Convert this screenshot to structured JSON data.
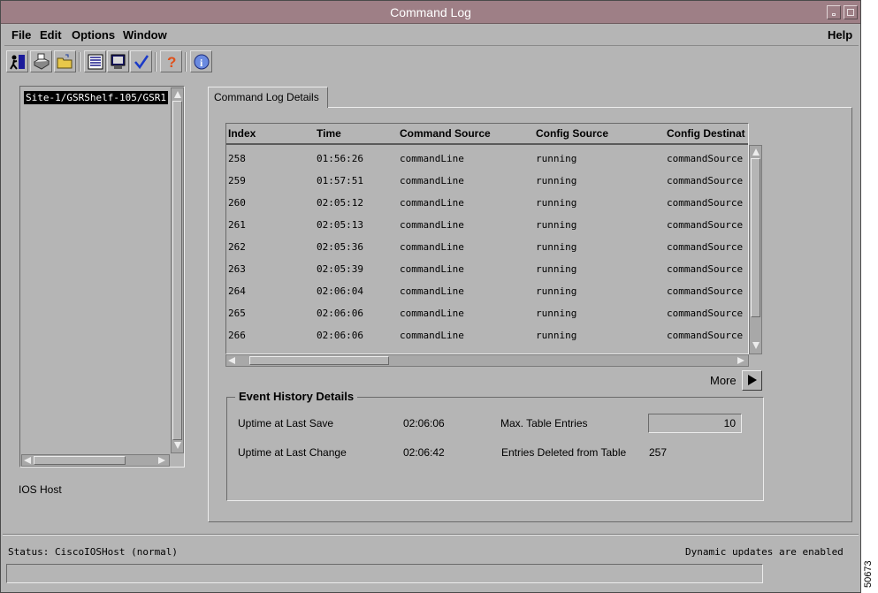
{
  "window": {
    "title": "Command Log"
  },
  "menu": {
    "file": "File",
    "edit": "Edit",
    "options": "Options",
    "window": "Window",
    "help": "Help"
  },
  "toolbar": {
    "icons": [
      "exit-icon",
      "print-icon",
      "open-folder-icon",
      "list-icon",
      "monitor-icon",
      "checkmark-icon",
      "question-help-icon",
      "info-icon"
    ]
  },
  "tree": {
    "selected_node": "Site-1/GSRShelf-105/GSR1",
    "footer_label": "IOS Host"
  },
  "tab": {
    "label": "Command Log Details"
  },
  "table": {
    "columns": [
      "Index",
      "Time",
      "Command Source",
      "Config Source",
      "Config Destinat"
    ],
    "rows": [
      [
        "258",
        "01:56:26",
        "commandLine",
        "running",
        "commandSource"
      ],
      [
        "259",
        "01:57:51",
        "commandLine",
        "running",
        "commandSource"
      ],
      [
        "260",
        "02:05:12",
        "commandLine",
        "running",
        "commandSource"
      ],
      [
        "261",
        "02:05:13",
        "commandLine",
        "running",
        "commandSource"
      ],
      [
        "262",
        "02:05:36",
        "commandLine",
        "running",
        "commandSource"
      ],
      [
        "263",
        "02:05:39",
        "commandLine",
        "running",
        "commandSource"
      ],
      [
        "264",
        "02:06:04",
        "commandLine",
        "running",
        "commandSource"
      ],
      [
        "265",
        "02:06:06",
        "commandLine",
        "running",
        "commandSource"
      ],
      [
        "266",
        "02:06:06",
        "commandLine",
        "running",
        "commandSource"
      ]
    ]
  },
  "more": {
    "label": "More"
  },
  "event_history": {
    "title": "Event History Details",
    "uptime_last_save_label": "Uptime at Last Save",
    "uptime_last_save_value": "02:06:06",
    "uptime_last_change_label": "Uptime at Last Change",
    "uptime_last_change_value": "02:06:42",
    "max_entries_label": "Max. Table Entries",
    "max_entries_value": "10",
    "entries_deleted_label": "Entries Deleted from Table",
    "entries_deleted_value": "257"
  },
  "status": {
    "left": "Status: CiscoIOSHost (normal)",
    "right": "Dynamic updates are enabled"
  },
  "figure_number": "50673",
  "colors": {
    "window_bg": "#b5b5b5",
    "titlebar": "#9e7f86",
    "selection": "#000000"
  }
}
